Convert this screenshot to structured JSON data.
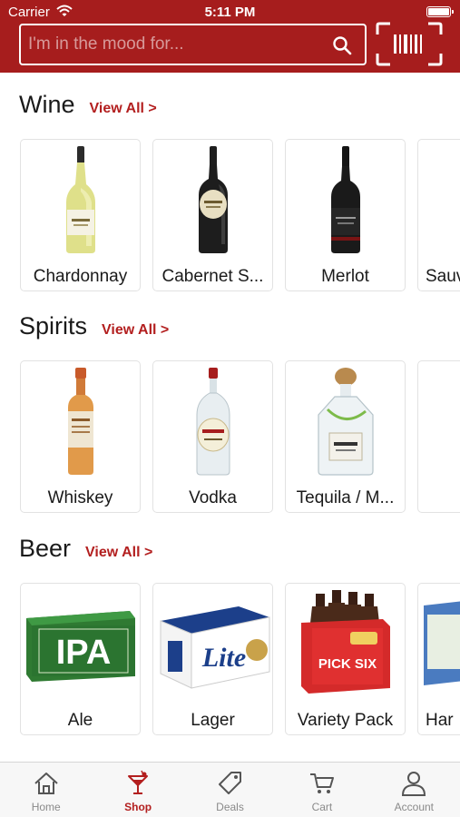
{
  "status_bar": {
    "carrier": "Carrier",
    "time": "5:11 PM"
  },
  "search": {
    "placeholder": "I'm in the mood for...",
    "value": ""
  },
  "colors": {
    "brand": "#a61d1d",
    "accent": "#b31f1f"
  },
  "sections": [
    {
      "title": "Wine",
      "view_all": "View All >",
      "items": [
        {
          "label": "Chardonnay",
          "icon": "white-wine-bottle"
        },
        {
          "label": "Cabernet S...",
          "icon": "red-wine-bottle"
        },
        {
          "label": "Merlot",
          "icon": "dark-wine-bottle"
        },
        {
          "label": "Sauv",
          "icon": "wine-bottle"
        }
      ]
    },
    {
      "title": "Spirits",
      "view_all": "View All >",
      "items": [
        {
          "label": "Whiskey",
          "icon": "whiskey-bottle"
        },
        {
          "label": "Vodka",
          "icon": "vodka-bottle"
        },
        {
          "label": "Tequila / M...",
          "icon": "tequila-bottle"
        },
        {
          "label": "",
          "icon": "spirit-bottle"
        }
      ]
    },
    {
      "title": "Beer",
      "view_all": "View All >",
      "items": [
        {
          "label": "Ale",
          "icon": "ipa-case",
          "art_text": "IPA"
        },
        {
          "label": "Lager",
          "icon": "lite-case",
          "art_text": "Lite"
        },
        {
          "label": "Variety Pack",
          "icon": "six-pack",
          "art_text": "PICK SIX"
        },
        {
          "label": "Har",
          "icon": "beer-case"
        }
      ]
    }
  ],
  "tabs": [
    {
      "label": "Home",
      "icon": "home-icon",
      "active": false
    },
    {
      "label": "Shop",
      "icon": "cocktail-icon",
      "active": true
    },
    {
      "label": "Deals",
      "icon": "tag-icon",
      "active": false
    },
    {
      "label": "Cart",
      "icon": "cart-icon",
      "active": false
    },
    {
      "label": "Account",
      "icon": "account-icon",
      "active": false
    }
  ]
}
